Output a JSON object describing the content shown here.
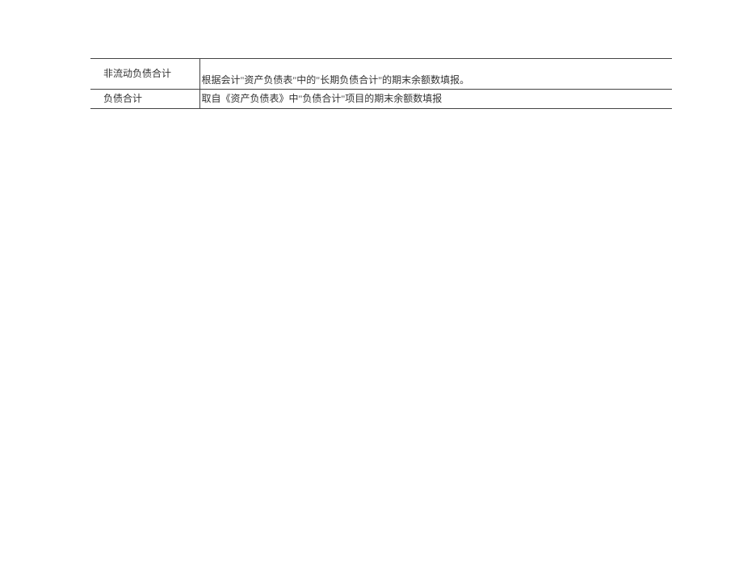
{
  "table": {
    "rows": [
      {
        "label": "非流动负债合计",
        "desc": "根据会计\"资产负债表\"中的\"长期负债合计\"的期末余额数填报。"
      },
      {
        "label": "负债合计",
        "desc": "取自《资产负债表》中\"负债合计\"项目的期末余额数填报"
      }
    ]
  }
}
